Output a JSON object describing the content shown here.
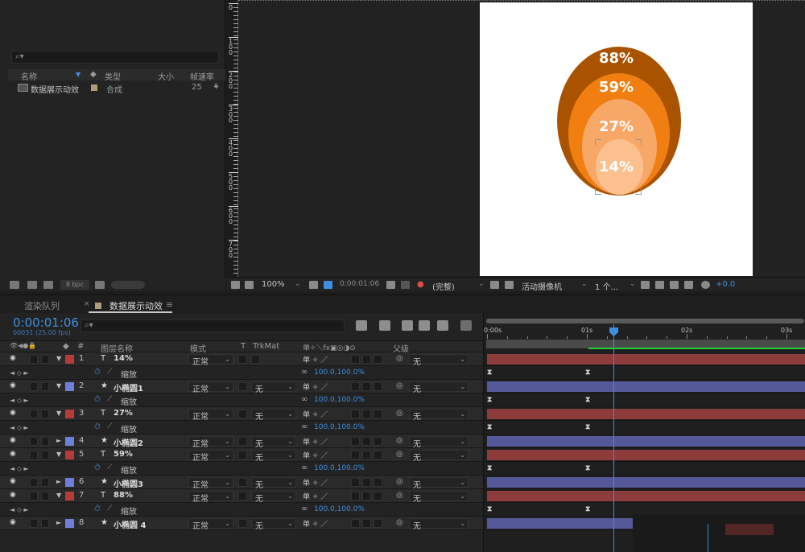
{
  "project": {
    "search_icon": "⌕▾",
    "columns": {
      "name": "名称",
      "type": "类型",
      "size": "大小",
      "fps": "帧速率"
    },
    "items": [
      {
        "name": "数据展示动效",
        "type": "合成",
        "fps": "25"
      }
    ],
    "bpc": "8 bpc"
  },
  "viewer": {
    "ruler_numbers": [
      "0",
      "1\n0\n0",
      "2\n0\n0",
      "3\n0\n0",
      "4\n0\n0",
      "5\n0\n0",
      "6\n0\n0",
      "7\n0\n0"
    ],
    "zoom": "100%",
    "timecode": "0:00:01:06",
    "resolution": "(完整)",
    "camera": "活动摄像机",
    "views": "1 个...",
    "exposure": "+0.0",
    "canvas_labels": [
      "88%",
      "59%",
      "27%",
      "14%"
    ],
    "colors": {
      "outer": "#a95300",
      "mid": "#f07e10",
      "inner": "#f8a866",
      "core": "#fcc08e"
    }
  },
  "timeline": {
    "tabs": [
      "渲染队列",
      "数据展示动效"
    ],
    "tab_close": "×",
    "tab_menu": "≡",
    "timecode": "0:00:01:06",
    "timecode_sub": "00031 (25.00 fps)",
    "search_icon": "⌕▾",
    "header": {
      "icons": "👁◀●🔒",
      "label_icon": "◆",
      "num": "#",
      "name": "图层名称",
      "mode": "模式",
      "t": "T",
      "trkmat": "TrkMat",
      "switches": "单✧＼fx▣◎◑⊙",
      "parent": "父级"
    },
    "rows": [
      {
        "kind": "layer",
        "num": "1",
        "type": "T",
        "name": "14%",
        "label": "#b83b3b",
        "tri": "▼",
        "mode": "正常",
        "trkmat": "",
        "parent": "无"
      },
      {
        "kind": "prop",
        "name": "缩放",
        "value": "100.0,100.0%"
      },
      {
        "kind": "layer",
        "num": "2",
        "type": "★",
        "name": "小椭圆1",
        "label": "#6f7fd8",
        "tri": "▼",
        "mode": "正常",
        "trkmat": "无",
        "parent": "无"
      },
      {
        "kind": "prop",
        "name": "缩放",
        "value": "100.0,100.0%"
      },
      {
        "kind": "layer",
        "num": "3",
        "type": "T",
        "name": "27%",
        "label": "#b83b3b",
        "tri": "▼",
        "mode": "正常",
        "trkmat": "无",
        "parent": "无"
      },
      {
        "kind": "prop",
        "name": "缩放",
        "value": "100.0,100.0%"
      },
      {
        "kind": "layer",
        "num": "4",
        "type": "★",
        "name": "小椭圆2",
        "label": "#6f7fd8",
        "tri": "►",
        "mode": "正常",
        "trkmat": "无",
        "parent": "无"
      },
      {
        "kind": "layer",
        "num": "5",
        "type": "T",
        "name": "59%",
        "label": "#b83b3b",
        "tri": "▼",
        "mode": "正常",
        "trkmat": "无",
        "parent": "无"
      },
      {
        "kind": "prop",
        "name": "缩放",
        "value": "100.0,100.0%"
      },
      {
        "kind": "layer",
        "num": "6",
        "type": "★",
        "name": "小椭圆3",
        "label": "#6f7fd8",
        "tri": "►",
        "mode": "正常",
        "trkmat": "无",
        "parent": "无"
      },
      {
        "kind": "layer",
        "num": "7",
        "type": "T",
        "name": "88%",
        "label": "#b83b3b",
        "tri": "▼",
        "mode": "正常",
        "trkmat": "无",
        "parent": "无"
      },
      {
        "kind": "prop",
        "name": "缩放",
        "value": "100.0,100.0%"
      },
      {
        "kind": "layer",
        "num": "8",
        "type": "★",
        "name": "小椭圆 4",
        "label": "#6f7fd8",
        "tri": "►",
        "mode": "正常",
        "trkmat": "无",
        "parent": "无"
      }
    ],
    "ruler_labels": [
      "0:00s",
      "01s",
      "02s",
      "03s"
    ],
    "keyframe_glyph": "⧗",
    "bar_colors": {
      "text": "#8e3b3b",
      "shape": "#55599a"
    },
    "cti_color": "#3d8ee0"
  }
}
